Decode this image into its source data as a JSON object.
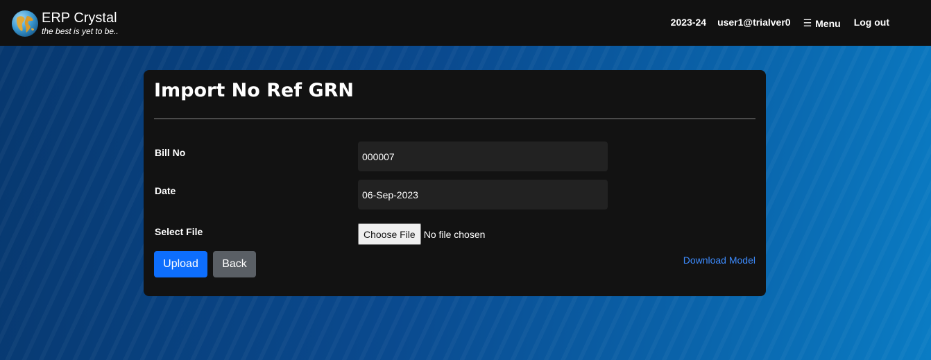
{
  "header": {
    "app_title": "ERP Crystal",
    "tagline": "the best is yet to be..",
    "logo_icon": "globe-icon",
    "fiscal_year": "2023-24",
    "user": "user1@trialver0",
    "menu_icon": "hamburger-icon",
    "menu_label": "Menu",
    "logout_label": "Log out"
  },
  "form": {
    "title": "Import No Ref GRN",
    "bill_no_label": "Bill No",
    "bill_no_value": "000007",
    "date_label": "Date",
    "date_value": "06-Sep-2023",
    "select_file_label": "Select File",
    "choose_file_label": "Choose File",
    "file_status": "No file chosen",
    "upload_label": "Upload",
    "back_label": "Back",
    "download_model_label": "Download Model"
  },
  "colors": {
    "navbar": "#111111",
    "card": "#121212",
    "primary": "#0d6efd",
    "secondary": "#5a5f65",
    "link": "#3d8bfd"
  }
}
